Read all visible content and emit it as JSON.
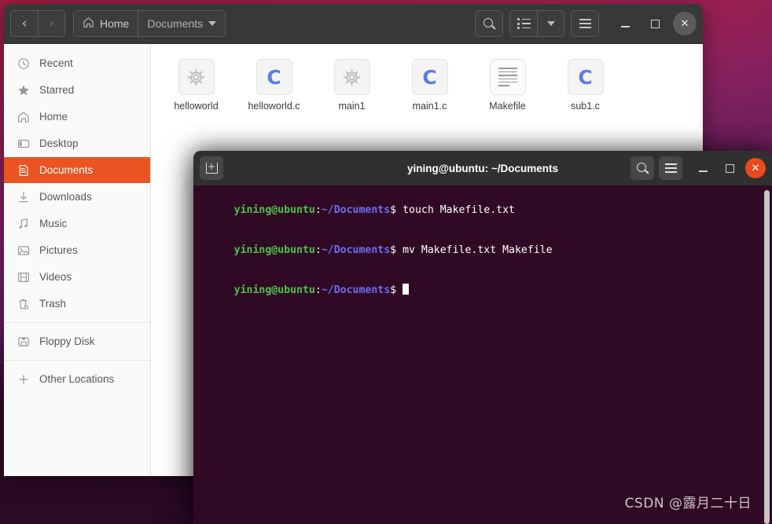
{
  "desktop": {
    "watermark": "CSDN @露月二十日",
    "background_top_color": "#a11c43",
    "background_bottom_color": "#2a0a26"
  },
  "file_manager": {
    "nav": {
      "back_label": "‹",
      "forward_label": "›",
      "back_icon": "chevron-left-icon",
      "forward_icon": "chevron-right-icon"
    },
    "breadcrumb": [
      {
        "label": "Home",
        "icon": "home-icon",
        "active": false
      },
      {
        "label": "Documents",
        "icon": "",
        "active": true
      }
    ],
    "path_dropdown_icon": "chevron-down-icon",
    "toolbar": {
      "search_icon": "search-icon",
      "view_list_icon": "list-view-icon",
      "view_dropdown_icon": "chevron-down-icon",
      "menu_icon": "hamburger-menu-icon",
      "minimize_label": "–",
      "maximize_label": "□",
      "close_label": "✕"
    },
    "sidebar": {
      "items": [
        {
          "label": "Recent",
          "icon": "clock-icon",
          "active": false
        },
        {
          "label": "Starred",
          "icon": "star-icon",
          "active": false
        },
        {
          "label": "Home",
          "icon": "home-icon",
          "active": false
        },
        {
          "label": "Desktop",
          "icon": "desktop-icon",
          "active": false
        },
        {
          "label": "Documents",
          "icon": "documents-icon",
          "active": true
        },
        {
          "label": "Downloads",
          "icon": "download-icon",
          "active": false
        },
        {
          "label": "Music",
          "icon": "music-icon",
          "active": false
        },
        {
          "label": "Pictures",
          "icon": "pictures-icon",
          "active": false
        },
        {
          "label": "Videos",
          "icon": "video-icon",
          "active": false
        },
        {
          "label": "Trash",
          "icon": "trash-icon",
          "active": false
        }
      ],
      "devices": [
        {
          "label": "Floppy Disk",
          "icon": "floppy-disk-icon",
          "active": false
        }
      ],
      "network": [
        {
          "label": "Other Locations",
          "icon": "plus-icon",
          "active": false
        }
      ],
      "active_color": "#e95420"
    },
    "files": [
      {
        "name": "helloworld",
        "icon": "executable-gear-icon"
      },
      {
        "name": "helloworld.c",
        "icon": "c-source-icon"
      },
      {
        "name": "main1",
        "icon": "executable-gear-icon"
      },
      {
        "name": "main1.c",
        "icon": "c-source-icon"
      },
      {
        "name": "Makefile",
        "icon": "text-document-icon"
      },
      {
        "name": "sub1.c",
        "icon": "c-source-icon"
      }
    ]
  },
  "terminal": {
    "title": "yining@ubuntu: ~/Documents",
    "new_tab_icon": "new-tab-icon",
    "search_icon": "search-icon",
    "menu_icon": "hamburger-menu-icon",
    "minimize_label": "–",
    "maximize_label": "□",
    "close_label": "✕",
    "background_color": "#300a24",
    "prompt": {
      "user_host": "yining@ubuntu",
      "separator": ":",
      "path": "~/Documents",
      "dollar": "$"
    },
    "lines": [
      {
        "command": "touch Makefile.txt"
      },
      {
        "command": "mv Makefile.txt Makefile"
      },
      {
        "command": ""
      }
    ]
  }
}
